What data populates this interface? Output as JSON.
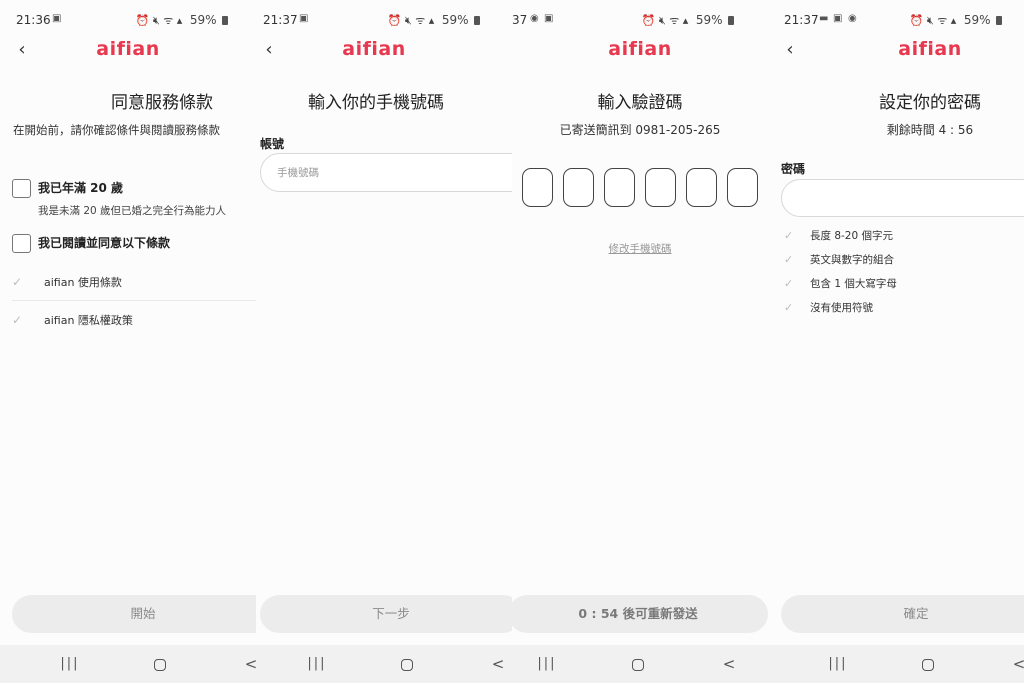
{
  "brand": {
    "name": "aifian",
    "color": "#e8384f"
  },
  "screens": [
    {
      "status": {
        "time": "21:36",
        "battery": "59%"
      },
      "title": "同意服務條款",
      "intro": "在開始前，請你確認條件與閱讀服務條款",
      "checkboxes": [
        {
          "label": "我已年滿 20 歲",
          "sub": "我是未滿 20 歲但已婚之完全行為能力人"
        },
        {
          "label": "我已閱讀並同意以下條款"
        }
      ],
      "terms": [
        "aifian 使用條款",
        "aifian 隱私權政策"
      ],
      "button": "開始"
    },
    {
      "status": {
        "time": "21:37",
        "battery": "59%"
      },
      "title": "輸入你的手機號碼",
      "field_label": "帳號",
      "placeholder": "手機號碼",
      "button": "下一步"
    },
    {
      "status": {
        "time": "37",
        "battery": "59%"
      },
      "title": "輸入驗證碼",
      "subtitle": "已寄送簡訊到 0981-205-265",
      "code_length": 6,
      "change_link": "修改手機號碼",
      "button": "0 : 54 後可重新發送"
    },
    {
      "status": {
        "time": "21:37",
        "battery": "59%"
      },
      "title": "設定你的密碼",
      "subtitle": "剩餘時間 4 : 56",
      "field_label": "密碼",
      "rules": [
        "長度 8-20 個字元",
        "英文與數字的組合",
        "包含 1 個大寫字母",
        "沒有使用符號"
      ],
      "button": "確定"
    }
  ],
  "nav": {
    "recent": "|||",
    "back": "<"
  },
  "icons": [
    "image-icon",
    "chat-icon",
    "messenger-icon",
    "alarm-icon",
    "mute-icon",
    "wifi-icon",
    "signal-icon",
    "battery-icon",
    "back-arrow-icon",
    "check-icon"
  ]
}
